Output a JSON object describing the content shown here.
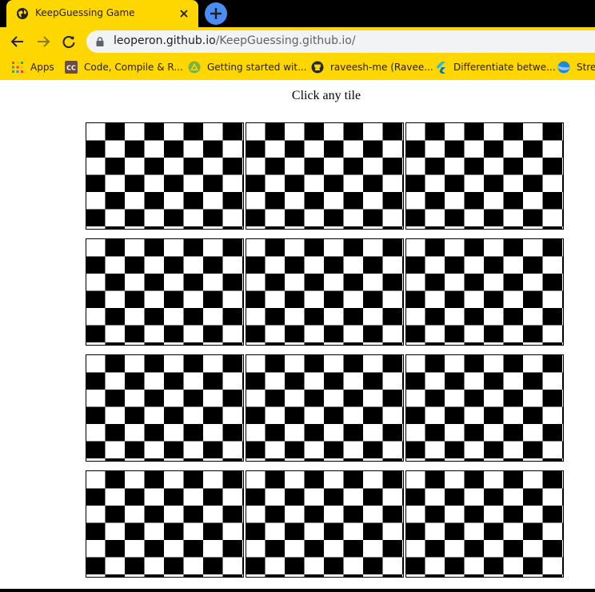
{
  "browser": {
    "tab": {
      "title": "KeepGuessing Game",
      "favicon": "globe-icon"
    },
    "address": {
      "host": "leoperon.github.io",
      "path": "/KeepGuessing.github.io/"
    },
    "bookmarks": [
      {
        "label": "Apps",
        "icon": "apps-grid-icon",
        "color": "#ea4335"
      },
      {
        "label": "Code, Compile & R...",
        "icon": "cc-icon",
        "color": "#6d4c41"
      },
      {
        "label": "Getting started wit...",
        "icon": "triangle-icon",
        "color": "#7cb342"
      },
      {
        "label": "raveesh-me (Ravee...",
        "icon": "github-icon",
        "color": "#24292e"
      },
      {
        "label": "Differentiate betwe...",
        "icon": "flutter-icon",
        "color": "#29b6f6"
      },
      {
        "label": "Strea",
        "icon": "stream-icon",
        "color": "#1e88e5"
      }
    ],
    "colors": {
      "theme": "#ffd700",
      "tabstrip": "#000000",
      "newtab": "#4a8ef5"
    }
  },
  "page": {
    "instruction": "Click any tile",
    "tiles": [
      {
        "id": 1
      },
      {
        "id": 2
      },
      {
        "id": 3
      },
      {
        "id": 4
      },
      {
        "id": 5
      },
      {
        "id": 6
      },
      {
        "id": 7
      },
      {
        "id": 8
      },
      {
        "id": 9
      },
      {
        "id": 10
      },
      {
        "id": 11
      },
      {
        "id": 12
      }
    ],
    "tile_pattern": "black-white-checkerboard"
  }
}
